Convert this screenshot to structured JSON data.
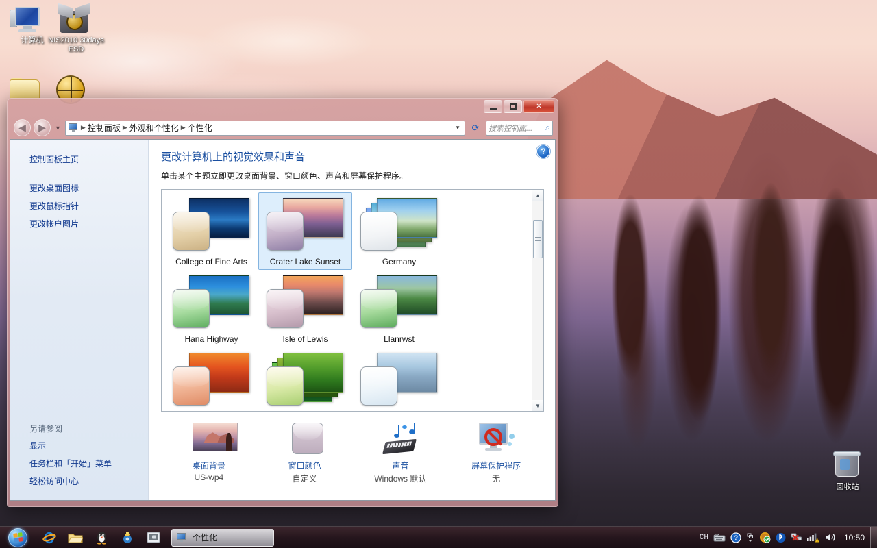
{
  "desktop": {
    "icons": [
      {
        "label": "计算机",
        "icon": "computer-icon"
      },
      {
        "label": "NIS2010\n30days ESD",
        "label_line1": "NIS2010",
        "label_line2": "30days ESD",
        "icon": "package-globe-icon"
      },
      {
        "label": "回收站",
        "icon": "recycle-bin-icon"
      }
    ]
  },
  "window": {
    "title": "个性化",
    "buttons": {
      "minimize": "最小化",
      "maximize": "最大化",
      "close": "关闭"
    },
    "address": {
      "icon": "control-panel-icon",
      "breadcrumbs": [
        "控制面板",
        "外观和个性化",
        "个性化"
      ],
      "dropdown_label": "▼",
      "refresh_label": "刷新"
    },
    "search": {
      "placeholder": "搜索控制面...",
      "value": "",
      "icon": "search-icon"
    },
    "help_label": "?"
  },
  "sidebar": {
    "home_link": "控制面板主页",
    "links": [
      "更改桌面图标",
      "更改鼠标指针",
      "更改帐户图片"
    ],
    "see_also_heading": "另请参阅",
    "see_also_links": [
      "显示",
      "任务栏和「开始」菜单",
      "轻松访问中心"
    ]
  },
  "main": {
    "title": "更改计算机上的视觉效果和声音",
    "subtitle": "单击某个主题立即更改桌面背景、窗口颜色、声音和屏幕保护程序。",
    "themes": [
      {
        "name": "College of Fine Arts",
        "selected": false,
        "stack": 1,
        "photo": "linear-gradient(180deg,#0d2f63 0%,#17539c 35%,#2b7bc4 55%,#0c3a72 78%,#071f42 100%)",
        "swatch": "linear-gradient(170deg,#f6ecd9,#e3cfa7 60%,#cbb184)"
      },
      {
        "name": "Crater Lake Sunset",
        "selected": true,
        "stack": 1,
        "photo": "linear-gradient(180deg,#f7d9bd 0%,#e9a9a0 22%,#b8789a 45%,#7d5f92 66%,#3d3a52 100%)",
        "swatch": "linear-gradient(170deg,#e9e0ea,#c3b0c8 55%,#8f7fa6)"
      },
      {
        "name": "Germany",
        "selected": false,
        "stack": 3,
        "photo": "linear-gradient(180deg,#5fa9e3 0%,#9fd0ef 30%,#cfe4c7 58%,#7fa86b 80%,#4b7340 100%)",
        "swatch": "linear-gradient(170deg,#ffffff,#f2f4f6 60%,#dfe4e9)"
      },
      {
        "name": "Hana Highway",
        "selected": false,
        "stack": 1,
        "photo": "linear-gradient(180deg,#1a70c4 0%,#2d8fdd 28%,#4aa8c9 48%,#2f7a4e 72%,#1d5432 100%)",
        "swatch": "linear-gradient(170deg,#eaf7e6,#a8dca0 55%,#5fae60)"
      },
      {
        "name": "Isle of Lewis",
        "selected": false,
        "stack": 1,
        "photo": "linear-gradient(180deg,#f2a65a 0%,#e98a6a 22%,#c0786f 42%,#6b4a4a 70%,#2b2020 100%)",
        "swatch": "linear-gradient(170deg,#f3e7ec,#d8c0cd 55%,#b49aab)"
      },
      {
        "name": "Llanrwst",
        "selected": false,
        "stack": 1,
        "photo": "linear-gradient(180deg,#88b8de 0%,#9dc6a2 32%,#4d8a46 58%,#356a34 78%,#1f4a28 100%)",
        "swatch": "linear-gradient(170deg,#e9f7e4,#a6da9c 55%,#5cab5c)"
      },
      {
        "name": "",
        "selected": false,
        "stack": 1,
        "photo": "linear-gradient(180deg,#f0892c 0%,#e4541f 35%,#c23a1a 62%,#8d2a14 100%)",
        "swatch": "linear-gradient(170deg,#fde3d4,#f0b394 55%,#e08c66)"
      },
      {
        "name": "",
        "selected": false,
        "stack": 3,
        "photo": "linear-gradient(180deg,#7fbf3f 0%,#4f9a2a 40%,#2f7a1e 70%,#1d5414 100%)",
        "swatch": "linear-gradient(170deg,#fbf6d8,#d8e9a6 55%,#a9cf72)"
      },
      {
        "name": "",
        "selected": false,
        "stack": 1,
        "photo": "linear-gradient(180deg,#cfe3f2 0%,#a8c8e0 34%,#8aa9c4 60%,#6d8aa4 100%)",
        "swatch": "linear-gradient(170deg,#ffffff,#eef5fa 55%,#d7e6f1)"
      }
    ],
    "settings": [
      {
        "label": "桌面背景",
        "value": "US-wp4",
        "icon": "desktop-background-icon"
      },
      {
        "label": "窗口颜色",
        "value": "自定义",
        "icon": "window-color-icon"
      },
      {
        "label": "声音",
        "value": "Windows 默认",
        "icon": "sound-icon"
      },
      {
        "label": "屏幕保护程序",
        "value": "无",
        "icon": "screensaver-icon"
      }
    ],
    "scrollbar": {
      "up": "▲",
      "down": "▼"
    }
  },
  "taskbar": {
    "start_label": "开始",
    "quick_launch": [
      {
        "name": "internet-explorer-icon",
        "label": "Internet Explorer"
      },
      {
        "name": "folder-explorer-icon",
        "label": "Windows 资源管理器"
      },
      {
        "name": "qq-penguin-icon",
        "label": "QQ"
      },
      {
        "name": "media-player-icon",
        "label": "播放器"
      },
      {
        "name": "screen-capture-icon",
        "label": "截图"
      }
    ],
    "tasks": [
      {
        "label": "个性化",
        "icon": "personalization-icon",
        "active": true
      }
    ],
    "tray": [
      {
        "name": "input-method-indicator",
        "label": "CH"
      },
      {
        "name": "keyboard-icon",
        "label": "键盘"
      },
      {
        "name": "help-icon",
        "label": "帮助"
      },
      {
        "name": "show-hidden-icons-chevron",
        "label": "显示隐藏的图标"
      },
      {
        "name": "security-shield-icon",
        "label": "安全"
      },
      {
        "name": "bluetooth-icon",
        "label": "蓝牙"
      },
      {
        "name": "network-disconnected-icon",
        "label": "网络未连接"
      },
      {
        "name": "signal-warning-icon",
        "label": "信号"
      },
      {
        "name": "volume-icon",
        "label": "音量"
      }
    ],
    "clock": "10:50",
    "show_desktop_label": "显示桌面"
  }
}
